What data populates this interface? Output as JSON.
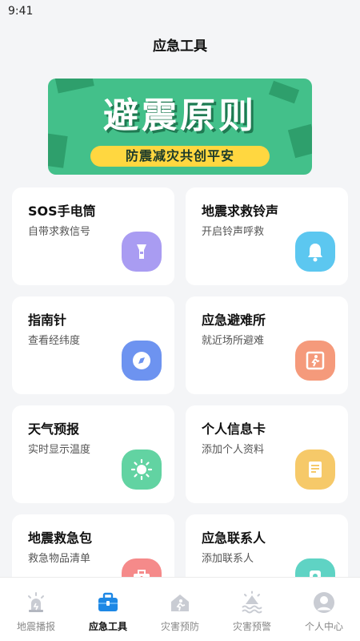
{
  "status_bar": {
    "time": "9:41"
  },
  "page": {
    "title": "应急工具"
  },
  "banner": {
    "title": "避震原则",
    "subtitle": "防震减灾共创平安"
  },
  "tools": [
    {
      "title": "SOS手电筒",
      "desc": "自带求救信号",
      "icon": "flashlight-icon",
      "color": "#a99cf2"
    },
    {
      "title": "地震求救铃声",
      "desc": "开启铃声呼救",
      "icon": "bell-icon",
      "color": "#5cc7f0"
    },
    {
      "title": "指南针",
      "desc": "查看经纬度",
      "icon": "compass-icon",
      "color": "#6d93f0"
    },
    {
      "title": "应急避难所",
      "desc": "就近场所避难",
      "icon": "shelter-exit-icon",
      "color": "#f59a7b"
    },
    {
      "title": "天气预报",
      "desc": "实时显示温度",
      "icon": "sun-icon",
      "color": "#62d3a2"
    },
    {
      "title": "个人信息卡",
      "desc": "添加个人资料",
      "icon": "info-card-icon",
      "color": "#f6c969"
    },
    {
      "title": "地震救急包",
      "desc": "救急物品清单",
      "icon": "emergency-kit-icon",
      "color": "#f58a8a"
    },
    {
      "title": "应急联系人",
      "desc": "添加联系人",
      "icon": "contact-icon",
      "color": "#5fd3c4"
    }
  ],
  "tabbar": {
    "active": 1,
    "tabs": [
      {
        "label": "地震播报",
        "icon": "siren-icon"
      },
      {
        "label": "应急工具",
        "icon": "toolbox-icon"
      },
      {
        "label": "灾害预防",
        "icon": "house-escape-icon"
      },
      {
        "label": "灾害预警",
        "icon": "flood-alert-icon"
      },
      {
        "label": "个人中心",
        "icon": "user-icon"
      }
    ]
  },
  "colors": {
    "accent": "#1e88e5",
    "banner_green": "#43c08a",
    "banner_yellow": "#ffd740"
  }
}
